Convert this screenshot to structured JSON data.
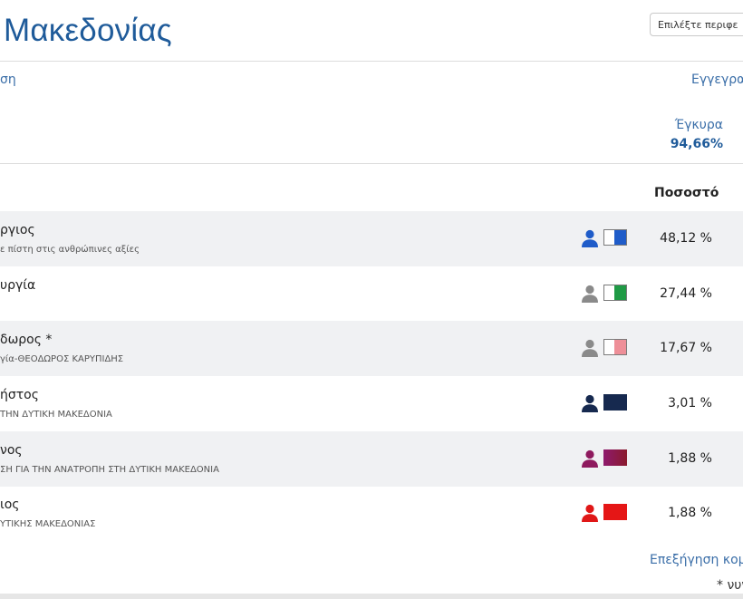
{
  "header": {
    "title": "Μακεδονίας",
    "region_select": {
      "value": "Επιλέξτε περιφε"
    }
  },
  "stats": {
    "left_label": "ση",
    "right_label": "Εγγεγρα",
    "valid": {
      "label": "Έγκυρα",
      "value": "94,66%"
    }
  },
  "table": {
    "column_percent": "Ποσοστό",
    "rows": [
      {
        "name": "ργιος",
        "party": "ε πίστη στις ανθρώπινες αξίες",
        "pct": "48,12 %",
        "person_color": "#1f5cc9",
        "swatch_outline": true,
        "swatch_fill": "#1f5cc9"
      },
      {
        "name": "υργία",
        "party": "",
        "pct": "27,44 %",
        "person_color": "#8a8a8a",
        "swatch_outline": true,
        "swatch_fill": "#1f9a45"
      },
      {
        "name": "δωρος *",
        "party": "γία-ΘΕΟΔΩΡΟΣ ΚΑΡΥΠΙΔΗΣ",
        "pct": "17,67 %",
        "person_color": "#8a8a8a",
        "swatch_outline": true,
        "swatch_fill": "#ee8f98"
      },
      {
        "name": "ήστος",
        "party": "ΤΗΝ ΔΥΤΙΚΗ ΜΑΚΕΔΟΝΙΑ",
        "pct": "3,01 %",
        "person_color": "#16294f",
        "swatch_outline": false,
        "swatch_fill": "#16294f"
      },
      {
        "name": "νος",
        "party": "ΣΗ ΓΙΑ ΤΗΝ ΑΝΑΤΡΟΠΗ ΣΤΗ ΔΥΤΙΚΗ ΜΑΚΕΔΟΝΙΑ",
        "pct": "1,88 %",
        "person_color": "#8e1a5e",
        "swatch_outline": false,
        "swatch_fill": "#8a1a2c"
      },
      {
        "name": "ιος",
        "party": "ΥΤΙΚΗΣ ΜΑΚΕΔΟΝΙΑΣ",
        "pct": "1,88 %",
        "person_color": "#e01717",
        "swatch_outline": false,
        "swatch_fill": "#e51616"
      }
    ]
  },
  "footer": {
    "explain_link": "Επεξήγηση κομ",
    "footnote": "* νυν"
  },
  "colors": {
    "title": "#1f5b9a",
    "link": "#3a6ea8",
    "row_shade": "#f0f1f3"
  }
}
